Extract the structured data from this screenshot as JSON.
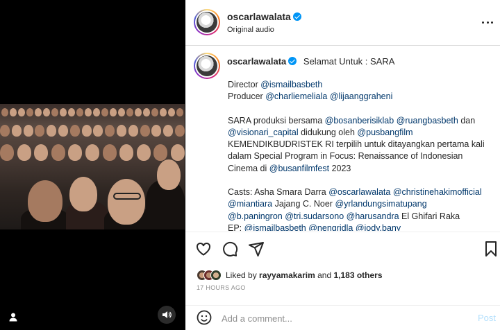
{
  "post": {
    "username": "oscarlawalata",
    "audio_label": "Original audio"
  },
  "caption": {
    "username": "oscarlawalata",
    "headline": "Selamat Untuk : SARA",
    "lines": [
      {
        "parts": [
          {
            "t": "Director ",
            "link": false
          },
          {
            "t": "@ismailbasbeth",
            "link": true
          }
        ]
      },
      {
        "parts": [
          {
            "t": "Producer ",
            "link": false
          },
          {
            "t": "@charliemeliala",
            "link": true
          },
          {
            "t": " ",
            "link": false
          },
          {
            "t": "@lijaanggraheni",
            "link": true
          }
        ]
      },
      {
        "gap": true
      },
      {
        "parts": [
          {
            "t": "SARA produksi bersama ",
            "link": false
          },
          {
            "t": "@bosanberisiklab",
            "link": true
          },
          {
            "t": " ",
            "link": false
          },
          {
            "t": "@ruangbasbeth",
            "link": true
          },
          {
            "t": " dan",
            "link": false
          }
        ]
      },
      {
        "parts": [
          {
            "t": "@visionari_capital",
            "link": true
          },
          {
            "t": " didukung oleh ",
            "link": false
          },
          {
            "t": "@pusbangfilm",
            "link": true
          }
        ]
      },
      {
        "parts": [
          {
            "t": "KEMENDIKBUDRISTEK RI terpilih untuk ditayangkan pertama kali",
            "link": false
          }
        ]
      },
      {
        "parts": [
          {
            "t": "dalam Special Program in Focus: Renaissance of Indonesian",
            "link": false
          }
        ]
      },
      {
        "parts": [
          {
            "t": "Cinema di ",
            "link": false
          },
          {
            "t": "@busanfilmfest",
            "link": true
          },
          {
            "t": " 2023",
            "link": false
          }
        ]
      },
      {
        "gap": true
      },
      {
        "parts": [
          {
            "t": "Casts: Asha Smara Darra ",
            "link": false
          },
          {
            "t": "@oscarlawalata",
            "link": true
          },
          {
            "t": " ",
            "link": false
          },
          {
            "t": "@christinehakimofficial",
            "link": true
          }
        ]
      },
      {
        "parts": [
          {
            "t": "@miantiara",
            "link": true
          },
          {
            "t": " Jajang C. Noer ",
            "link": false
          },
          {
            "t": "@yrlandungsimatupang",
            "link": true
          }
        ]
      },
      {
        "parts": [
          {
            "t": "@b.paningron",
            "link": true
          },
          {
            "t": " ",
            "link": false
          },
          {
            "t": "@tri.sudarsono",
            "link": true
          },
          {
            "t": " ",
            "link": false
          },
          {
            "t": "@harusandra",
            "link": true
          },
          {
            "t": " El Ghifari Raka",
            "link": false
          }
        ]
      },
      {
        "parts": [
          {
            "t": "EP: ",
            "link": false
          },
          {
            "t": "@ismailbasbeth",
            "link": true
          },
          {
            "t": " ",
            "link": false
          },
          {
            "t": "@nengridla",
            "link": true
          },
          {
            "t": " ",
            "link": false
          },
          {
            "t": "@jody.bany",
            "link": true
          }
        ]
      }
    ]
  },
  "likes": {
    "prefix": "Liked by ",
    "user": "rayyamakarim",
    "middle": " and ",
    "count": "1,183 others"
  },
  "timestamp": "17 HOURS AGO",
  "comment": {
    "placeholder": "Add a comment...",
    "post_label": "Post"
  },
  "icons": {
    "verified": "verified-badge-icon",
    "more": "more-options-icon",
    "like": "heart-icon",
    "comment": "comment-bubble-icon",
    "share": "paper-plane-icon",
    "save": "bookmark-icon",
    "emoji": "emoji-smiley-icon",
    "sound": "speaker-icon",
    "user": "user-tag-icon"
  },
  "colors": {
    "link": "#00376b",
    "verified": "#0095f6",
    "post_disabled": "#b2dffc",
    "muted": "#8e8e8e"
  }
}
